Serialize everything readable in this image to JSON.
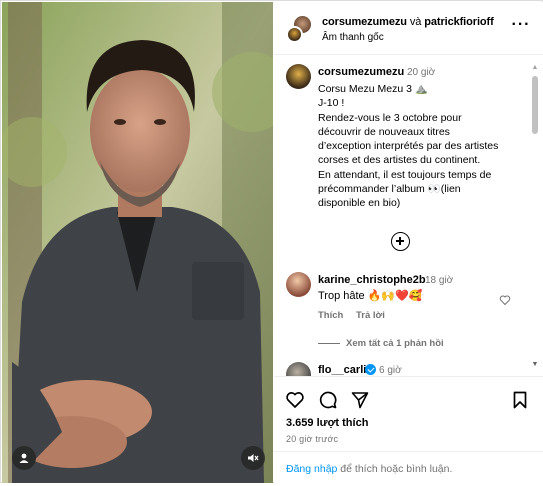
{
  "header": {
    "user1": "corsumezumezu",
    "joiner": "và",
    "user2": "patrickfiorioff",
    "audio": "Âm thanh gốc",
    "more_icon": "more-horizontal-icon"
  },
  "caption": {
    "username": "corsumezumezu",
    "time": "20 giờ",
    "lines": [
      "Corsu Mezu Mezu 3 ⛰️",
      "J-10 !",
      "Rendez-vous le 3 octobre pour",
      "découvrir de nouveaux titres",
      "d’exception interprétés par des artistes",
      "corses et des artistes du continent.",
      "En attendant, il est toujours temps de",
      "précommander l’album 👀(lien",
      "disponible en bio)"
    ]
  },
  "load_more_icon": "plus-circle-icon",
  "comments": [
    {
      "username": "karine_christophe2b",
      "time": "18 giờ",
      "text": "Trop hâte 🔥🙌❤️🥰",
      "like_label": "Thích",
      "reply_label": "Trả lời",
      "replies_label": "Xem tất cả 1 phản hồi"
    },
    {
      "username": "flo__carli",
      "time": "6 giờ",
      "verified": true
    }
  ],
  "actions": {
    "icons": [
      "heart-icon",
      "comment-icon",
      "share-icon",
      "bookmark-icon"
    ],
    "likes": "3.659 lượt thích",
    "posted": "20 giờ trước"
  },
  "login": {
    "link": "Đăng nhập",
    "rest": " để thích hoặc bình luận."
  },
  "colors": {
    "link": "#0095f6",
    "muted": "#737373",
    "border": "#dbdbdb"
  }
}
